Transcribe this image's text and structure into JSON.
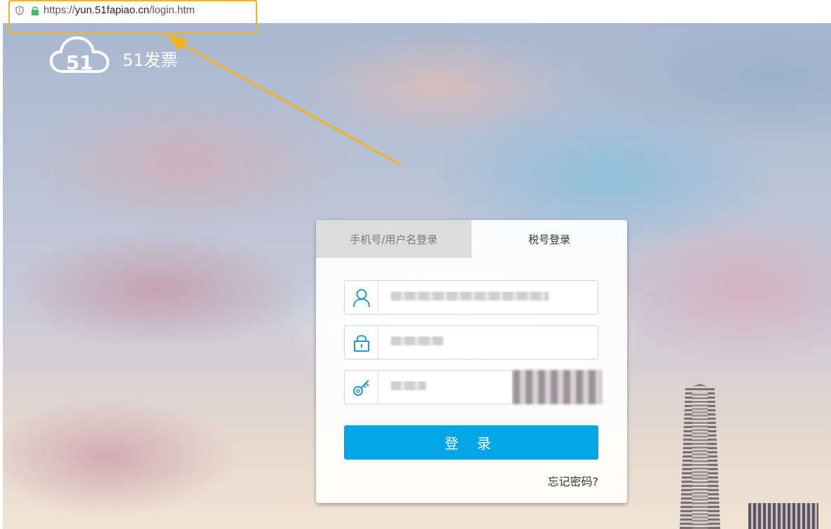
{
  "browser": {
    "url_prefix": "https://",
    "url_host": "yun.51fapiao.cn",
    "url_path": "/login.htm",
    "highlight_color": "#f5b21c",
    "shield_icon": "shield-icon",
    "lock_icon": "lock-icon"
  },
  "site": {
    "brand": "51发票",
    "logo_text": "51",
    "logo_icon": "cloud-51-logo"
  },
  "login": {
    "tabs": [
      {
        "label": "手机号/用户名登录",
        "active": false
      },
      {
        "label": "税号登录",
        "active": true
      }
    ],
    "fields": {
      "tax_id": {
        "icon": "user-icon"
      },
      "password": {
        "icon": "lock-icon"
      },
      "captcha": {
        "icon": "key-icon"
      }
    },
    "submit_label": "登 录",
    "forgot_label": "忘记密码?",
    "accent_color": "#03a6e5"
  }
}
